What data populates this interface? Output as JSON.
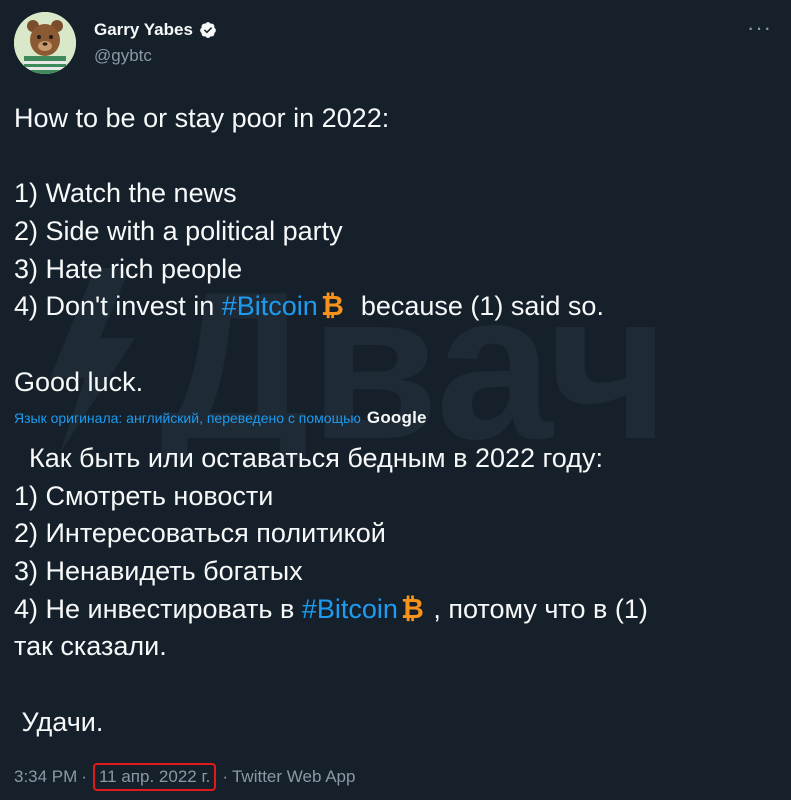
{
  "user": {
    "display_name": "Garry Yabes",
    "handle": "@gybtc",
    "verified_icon": "verified-badge-icon"
  },
  "more_icon": "more-dots-icon",
  "tweet": {
    "lines": [
      "How to be or stay poor in 2022:",
      "",
      "1) Watch the news",
      "2) Side with a political party",
      "3) Hate rich people"
    ],
    "line4_prefix": "4) Don't invest in ",
    "hashtag": "#Bitcoin",
    "line4_suffix": "  because (1) said so.",
    "closing": "Good luck."
  },
  "translation": {
    "notice": "Язык оригинала: английский, переведено с помощью",
    "provider": "Google",
    "lines": [
      "  Как быть или оставаться бедным в 2022 году:",
      "1) Смотреть новости",
      "2) Интересоваться политикой",
      "3) Ненавидеть богатых"
    ],
    "line4_prefix": "4) Не инвестировать в ",
    "hashtag": "#Bitcoin",
    "line4_suffix": " , потому что в (1)",
    "line5": "так сказали.",
    "closing": " Удачи."
  },
  "meta": {
    "time": "3:34 PM",
    "dot1": "·",
    "date": "11 апр. 2022 г.",
    "dot2": "·",
    "app": "Twitter Web App"
  },
  "watermark": "Двач",
  "colors": {
    "background": "#15202b",
    "text": "#f7f9f9",
    "muted": "#8b98a5",
    "link": "#1d9bf0",
    "bitcoin": "#f7931a",
    "highlight_box": "#e0191b"
  }
}
